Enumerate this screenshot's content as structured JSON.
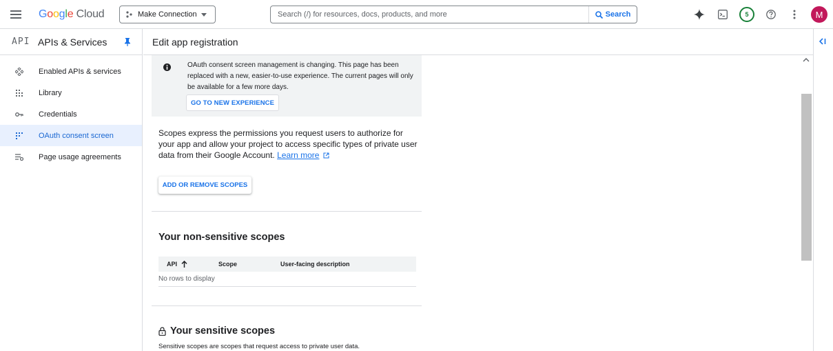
{
  "topbar": {
    "logo_google": [
      "G",
      "o",
      "o",
      "g",
      "l",
      "e"
    ],
    "logo_cloud": "Cloud",
    "project": "Make Connection",
    "search_placeholder": "Search (/) for resources, docs, products, and more",
    "search_button": "Search",
    "notification_count": "5",
    "avatar_initial": "M"
  },
  "sidebar": {
    "logo": "API",
    "title": "APIs & Services",
    "items": [
      {
        "label": "Enabled APIs & services",
        "icon": "api-hub-icon"
      },
      {
        "label": "Library",
        "icon": "library-icon"
      },
      {
        "label": "Credentials",
        "icon": "key-icon"
      },
      {
        "label": "OAuth consent screen",
        "icon": "consent-icon",
        "active": true
      },
      {
        "label": "Page usage agreements",
        "icon": "agreements-icon"
      }
    ]
  },
  "header": {
    "title": "Edit app registration"
  },
  "banner": {
    "text": "OAuth consent screen management is changing. This page has been replaced with a new, easier-to-use experience. The current pages will only be available for a few more days.",
    "button": "GO TO NEW EXPERIENCE"
  },
  "scopes": {
    "description": "Scopes express the permissions you request users to authorize for your app and allow your project to access specific types of private user data from their Google Account.",
    "learn_more": "Learn more",
    "add_button": "ADD OR REMOVE SCOPES"
  },
  "non_sensitive": {
    "title": "Your non-sensitive scopes",
    "columns": [
      "API",
      "Scope",
      "User-facing description"
    ],
    "empty": "No rows to display"
  },
  "sensitive": {
    "title": "Your sensitive scopes",
    "description": "Sensitive scopes are scopes that request access to private user data."
  },
  "colors": {
    "accent": "#1a73e8",
    "active_bg": "#e8f0fe",
    "banner_bg": "#f1f3f4",
    "avatar": "#c2185b",
    "badge": "#188038"
  }
}
